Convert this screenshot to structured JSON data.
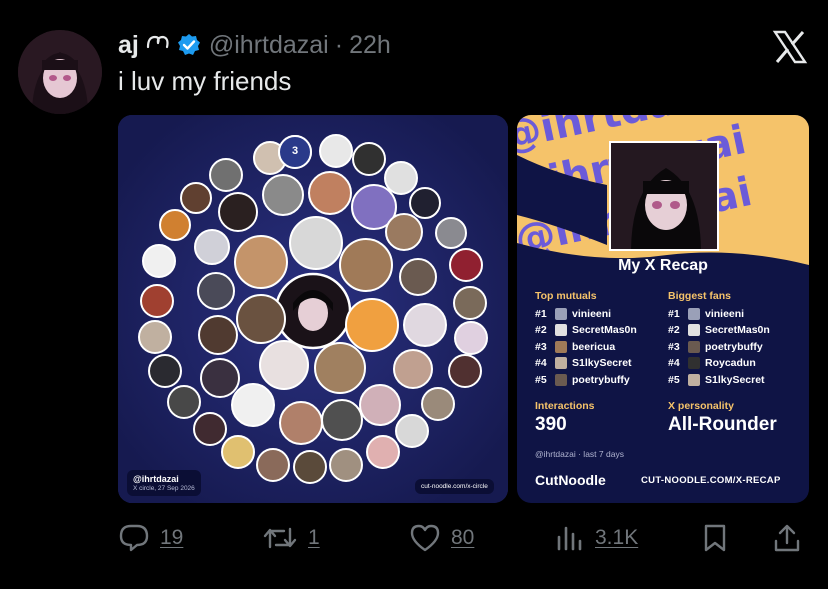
{
  "post": {
    "display_name": "aj",
    "handle": "@ihrtdazai",
    "separator": "·",
    "time": "22h",
    "text": "i luv my friends"
  },
  "media_left": {
    "circle_badge": "3",
    "tag_handle": "@ihrtdazai",
    "tag_sub": "X circle, 27 Sep 2026",
    "tag_url": "cut-noodle.com/x-circle"
  },
  "media_right": {
    "banner_handle": "@ihrtdazai",
    "title": "My X Recap",
    "top_mutuals_label": "Top mutuals",
    "biggest_fans_label": "Biggest fans",
    "top_mutuals": [
      {
        "rank": "#1",
        "name": "vinieeni"
      },
      {
        "rank": "#2",
        "name": "SecretMas0n"
      },
      {
        "rank": "#3",
        "name": "beericua"
      },
      {
        "rank": "#4",
        "name": "S1lkySecret"
      },
      {
        "rank": "#5",
        "name": "poetrybuffy"
      }
    ],
    "biggest_fans": [
      {
        "rank": "#1",
        "name": "vinieeni"
      },
      {
        "rank": "#2",
        "name": "SecretMas0n"
      },
      {
        "rank": "#3",
        "name": "poetrybuffy"
      },
      {
        "rank": "#4",
        "name": "Roycadun"
      },
      {
        "rank": "#5",
        "name": "S1lkySecret"
      }
    ],
    "interactions_label": "Interactions",
    "interactions_value": "390",
    "personality_label": "X personality",
    "personality_value": "All-Rounder",
    "meta": "@ihrtdazai · last 7 days",
    "brand": "CutNoodle",
    "brand_url": "CUT-NOODLE.COM/X-RECAP"
  },
  "actions": {
    "replies": "19",
    "reposts": "1",
    "likes": "80",
    "views": "3.1K"
  },
  "colors": {
    "background": "#000000",
    "text": "#e7e9ea",
    "muted": "#71767b",
    "verified": "#1d9bf0",
    "circle_bg": "#1a1f58",
    "recap_bg": "#0f1445",
    "recap_accent": "#f5c36a",
    "banner_text": "#6b5bd9"
  }
}
